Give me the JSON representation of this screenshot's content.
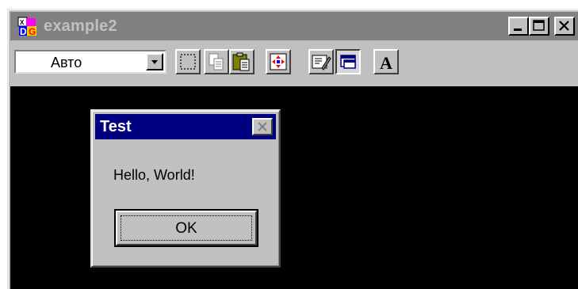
{
  "window": {
    "title": "example2",
    "app_icon": "app-logo-icon",
    "controls": [
      {
        "name": "minimize-button",
        "icon": "minimize-icon"
      },
      {
        "name": "maximize-button",
        "icon": "maximize-icon"
      },
      {
        "name": "close-button",
        "icon": "close-icon"
      }
    ]
  },
  "toolbar": {
    "zoom_select": {
      "value": "Авто",
      "arrow_icon": "chevron-down-icon"
    },
    "tools": [
      {
        "name": "select-button",
        "icon": "dashed-select-icon",
        "state": "raised"
      },
      {
        "name": "copy-button",
        "icon": "copy-icon",
        "state": "raised"
      },
      {
        "name": "paste-button",
        "icon": "paste-icon",
        "state": "raised"
      },
      {
        "name": "fit-button",
        "icon": "fit-arrows-icon",
        "state": "raised"
      },
      {
        "name": "properties-button",
        "icon": "properties-icon",
        "state": "raised"
      },
      {
        "name": "window-mode-button",
        "icon": "window-icon",
        "state": "pressed"
      },
      {
        "name": "font-button",
        "icon": "font-icon",
        "state": "raised",
        "label": "A"
      }
    ]
  },
  "dialog": {
    "title": "Test",
    "close_icon": "close-icon",
    "message": "Hello, World!",
    "ok_label": "OK"
  },
  "colors": {
    "face": "#c0c0c0",
    "inactive_titlebar": "#808080",
    "active_titlebar": "#000080",
    "canvas": "#000000"
  }
}
